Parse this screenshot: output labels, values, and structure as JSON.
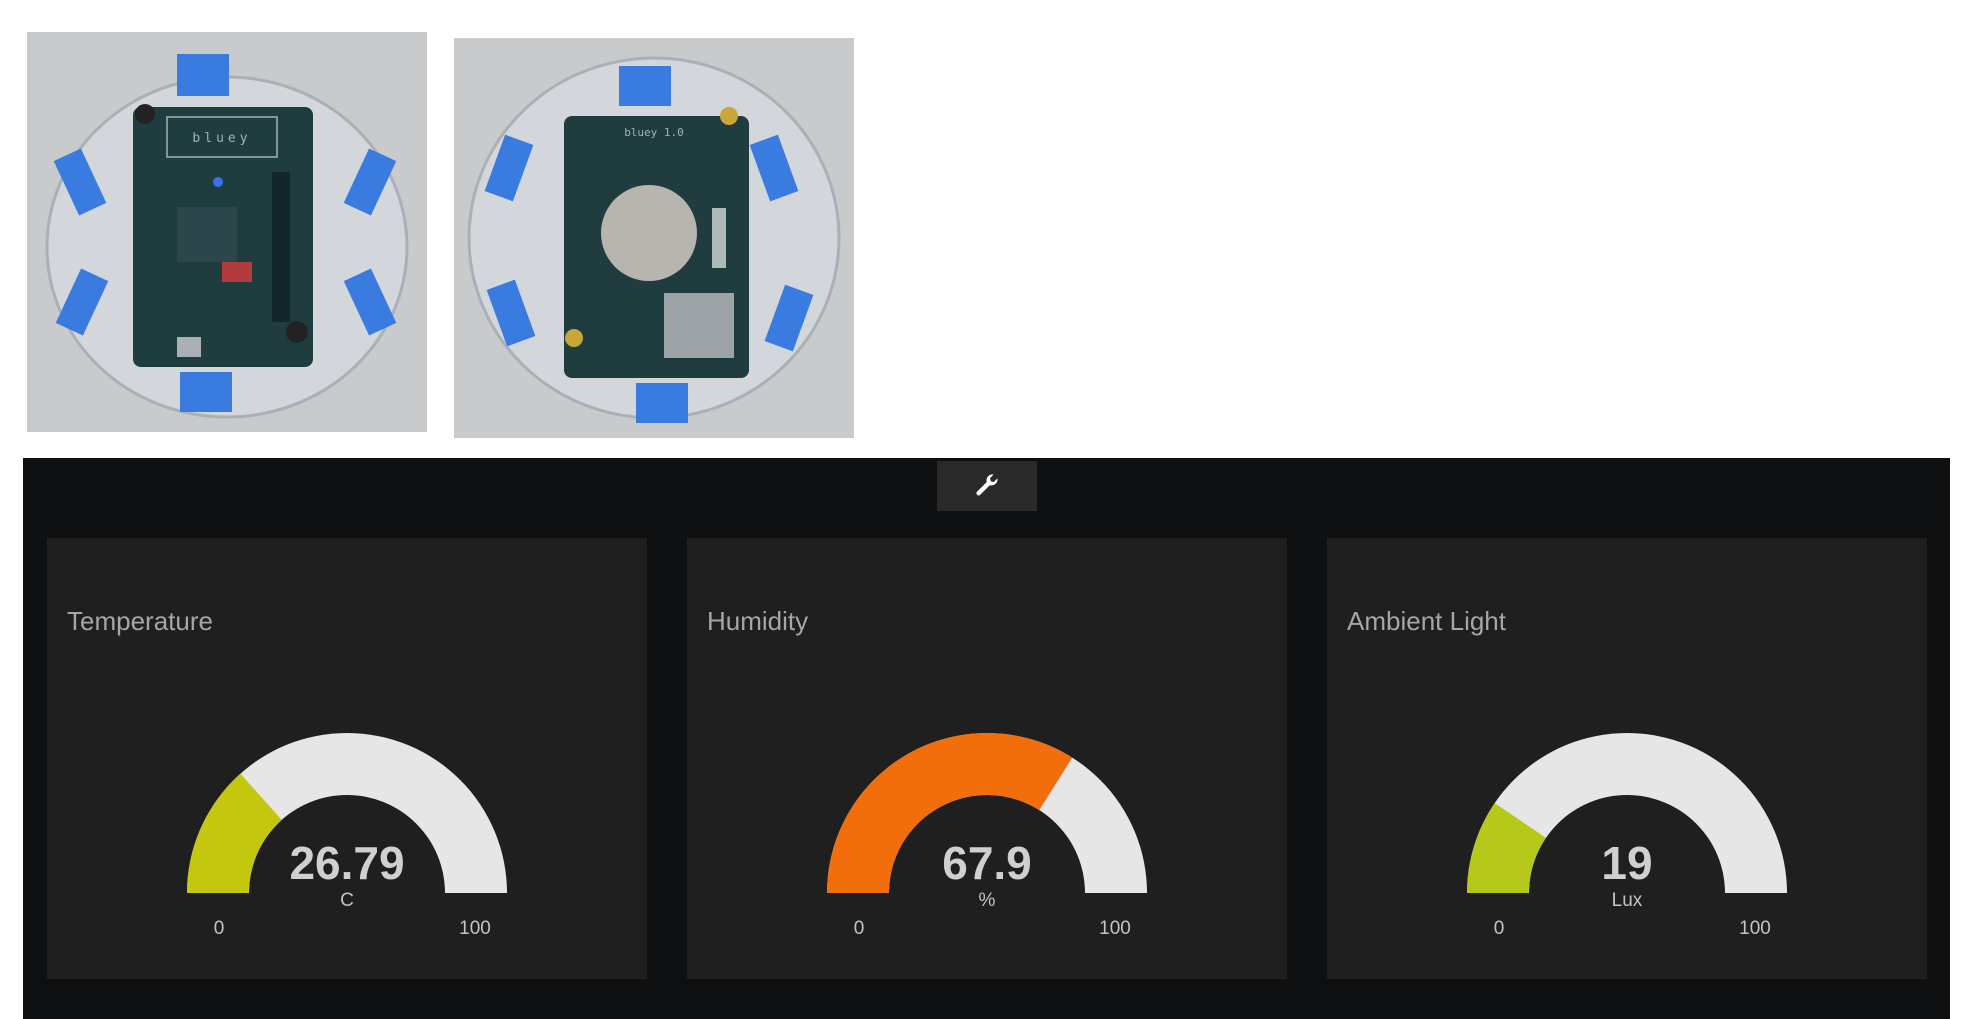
{
  "photos": [
    {
      "name": "bluey-board-front",
      "silkscreen": "bluey"
    },
    {
      "name": "bluey-board-back",
      "silkscreen": "bluey 1.0"
    }
  ],
  "toolbar": {
    "settings_icon": "wrench-icon"
  },
  "colors": {
    "dashboard_bg": "#0e0f11",
    "panel_bg": "#1f1f20",
    "gauge_track": "#e6e6e7",
    "gauge_low": "#c3c80f",
    "gauge_mid": "#f26d0b"
  },
  "gauges": {
    "temperature": {
      "title": "Temperature",
      "value": "26.79",
      "unit": "C",
      "min": "0",
      "max": "100",
      "fraction": 0.2679,
      "color": "#c3c80f"
    },
    "humidity": {
      "title": "Humidity",
      "value": "67.9",
      "unit": "%",
      "min": "0",
      "max": "100",
      "fraction": 0.679,
      "color": "#f26d0b"
    },
    "light": {
      "title": "Ambient Light",
      "value": "19",
      "unit": "Lux",
      "min": "0",
      "max": "100",
      "fraction": 0.19,
      "color": "#b6c81a"
    }
  }
}
